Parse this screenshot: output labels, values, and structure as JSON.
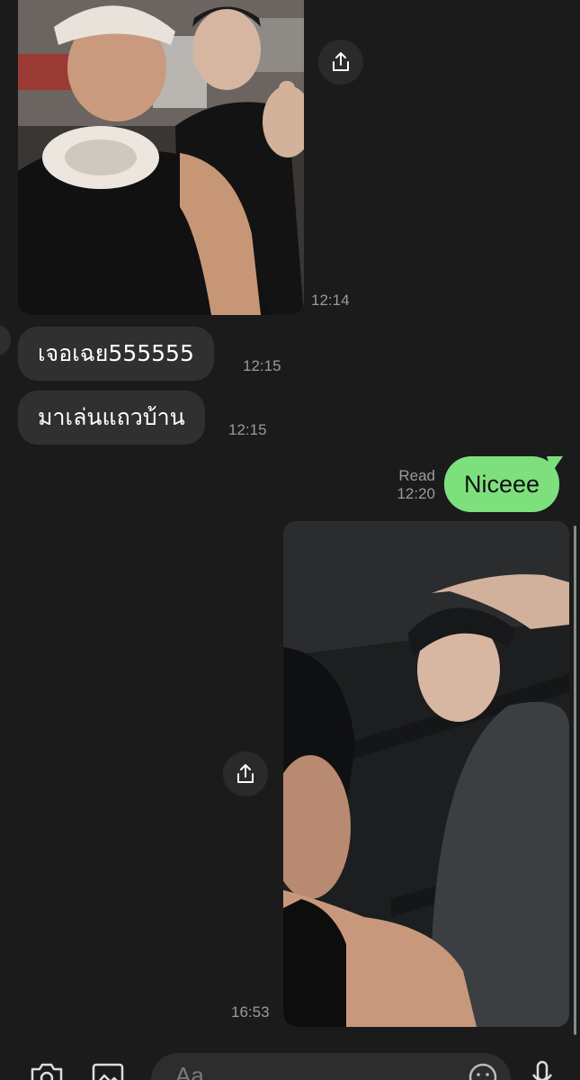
{
  "messages": {
    "incoming_photo": {
      "time": "12:14"
    },
    "incoming_text_1": {
      "text": "เจอเฉย555555",
      "time": "12:15"
    },
    "incoming_text_2": {
      "text": "มาเล่นแถวบ้าน",
      "time": "12:15"
    },
    "outgoing_text": {
      "text": "Niceee",
      "status": "Read",
      "time": "12:20"
    },
    "outgoing_photo": {
      "time": "16:53"
    }
  },
  "composer": {
    "placeholder": "Aa"
  },
  "icons": [
    "share-icon",
    "camera-icon",
    "image-icon",
    "emoji-icon",
    "microphone-icon"
  ],
  "colors": {
    "background": "#1b1b1b",
    "incoming_bubble": "#303030",
    "outgoing_bubble": "#7de07d",
    "timestamp": "#9a9a9a"
  }
}
